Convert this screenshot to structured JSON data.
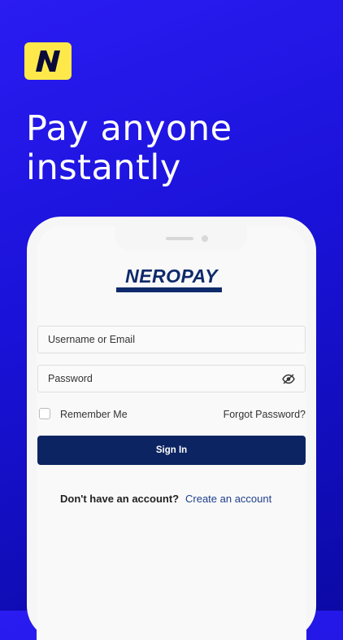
{
  "app_logo": {
    "letter": "N",
    "icon": "neropay-app-logo-icon"
  },
  "headline": {
    "line1": "Pay anyone",
    "line2": "instantly"
  },
  "login": {
    "brand": "NEROPAY",
    "username_placeholder": "Username or Email",
    "password_placeholder": "Password",
    "remember_label": "Remember Me",
    "forgot_label": "Forgot Password?",
    "signin_label": "Sign In",
    "no_account_text": "Don't have an account?",
    "create_account_link": "Create an account",
    "password_icon": "eye-slash-icon"
  },
  "colors": {
    "background": "#2a1cf2",
    "logo_bg": "#ffe94a",
    "primary": "#0c2461",
    "link": "#1f3f8c"
  }
}
